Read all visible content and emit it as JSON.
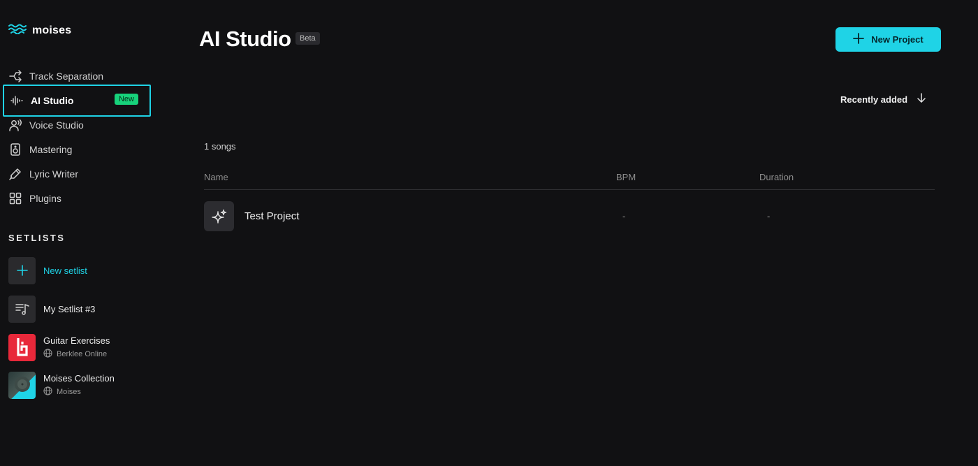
{
  "app": {
    "logo_text": "moises",
    "accent": "#1fd3e6"
  },
  "sidebar": {
    "items": [
      {
        "label": "Track Separation",
        "icon": "track-separation-icon"
      },
      {
        "label": "AI Studio",
        "icon": "waveform-icon",
        "badge": "New",
        "active": true
      },
      {
        "label": "Voice Studio",
        "icon": "voice-icon"
      },
      {
        "label": "Mastering",
        "icon": "speaker-icon"
      },
      {
        "label": "Lyric Writer",
        "icon": "pen-icon"
      },
      {
        "label": "Plugins",
        "icon": "grid-icon"
      }
    ],
    "setlists_title": "SETLISTS",
    "setlists": [
      {
        "title": "New setlist",
        "icon": "plus-icon"
      },
      {
        "title": "My Setlist #3",
        "icon": "playlist-icon"
      },
      {
        "title": "Guitar Exercises",
        "owner": "Berklee Online",
        "icon": "berklee-logo"
      },
      {
        "title": "Moises Collection",
        "owner": "Moises",
        "icon": "vinyl-cover"
      }
    ]
  },
  "main": {
    "title": "AI Studio",
    "badge": "Beta",
    "new_project_label": "New Project",
    "sort_label": "Recently added",
    "count_label": "1 songs",
    "columns": [
      "Name",
      "BPM",
      "Duration"
    ],
    "rows": [
      {
        "name": "Test Project",
        "bpm": "-",
        "duration": "-",
        "icon": "sparkle-icon"
      }
    ]
  }
}
